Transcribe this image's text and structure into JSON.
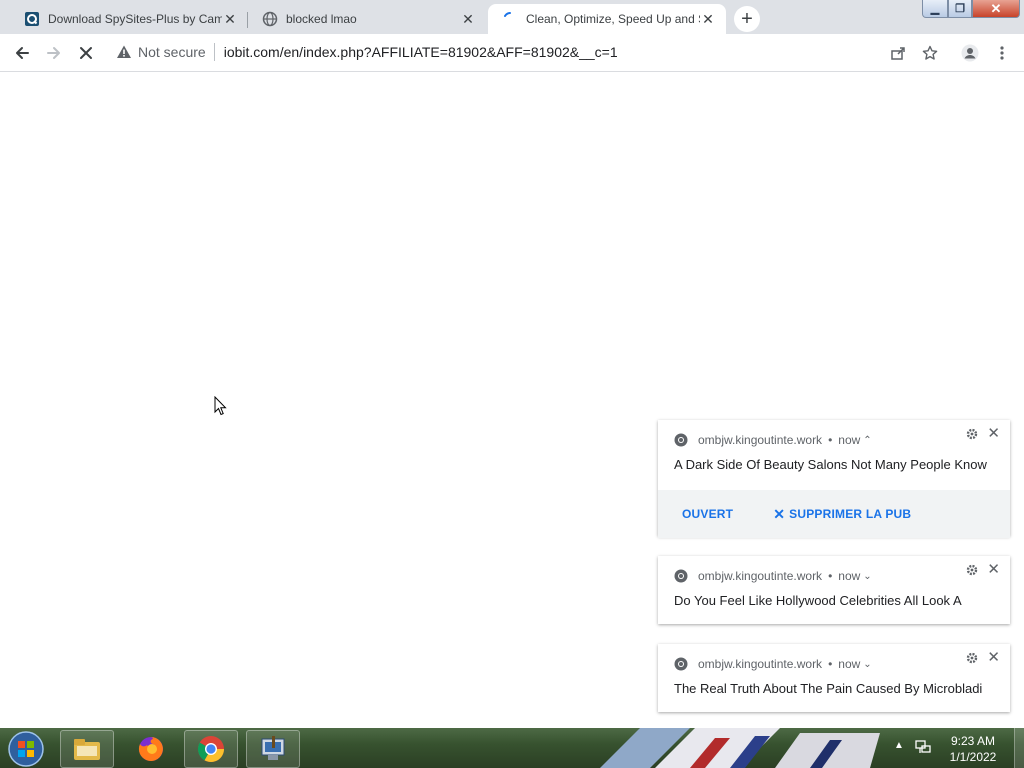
{
  "browser": {
    "tabs": [
      {
        "title": "Download SpySites-Plus by Camt",
        "favicon": "spysites-icon",
        "active": false
      },
      {
        "title": "blocked lmao",
        "favicon": "globe-icon",
        "active": false
      },
      {
        "title": "Clean, Optimize, Speed Up and S",
        "favicon": "loading-spinner-icon",
        "active": true
      }
    ],
    "new_tab_label": "+",
    "address": {
      "security_label": "Not secure",
      "url": "iobit.com/en/index.php?AFFILIATE=81902&AFF=81902&__c=1"
    }
  },
  "notifications": [
    {
      "source": "ombjw.kingoutinte.work",
      "time": "now",
      "expanded": true,
      "message": "A Dark Side Of Beauty Salons Not Many People Know",
      "actions": {
        "open": "OUVERT",
        "dismiss": "SUPPRIMER LA PUB"
      }
    },
    {
      "source": "ombjw.kingoutinte.work",
      "time": "now",
      "expanded": false,
      "message": "Do You Feel Like Hollywood Celebrities All Look A"
    },
    {
      "source": "ombjw.kingoutinte.work",
      "time": "now",
      "expanded": false,
      "message": "The Real Truth About The Pain Caused By Microbladi"
    }
  ],
  "taskbar": {
    "apps": [
      "windows-explorer-icon",
      "firefox-icon",
      "chrome-icon",
      "control-panel-icon"
    ],
    "clock": {
      "time": "9:23 AM",
      "date": "1/1/2022"
    }
  },
  "colors": {
    "accent": "#1a73e8",
    "tabstrip": "#dee1e6",
    "taskbar": "#37522f"
  }
}
